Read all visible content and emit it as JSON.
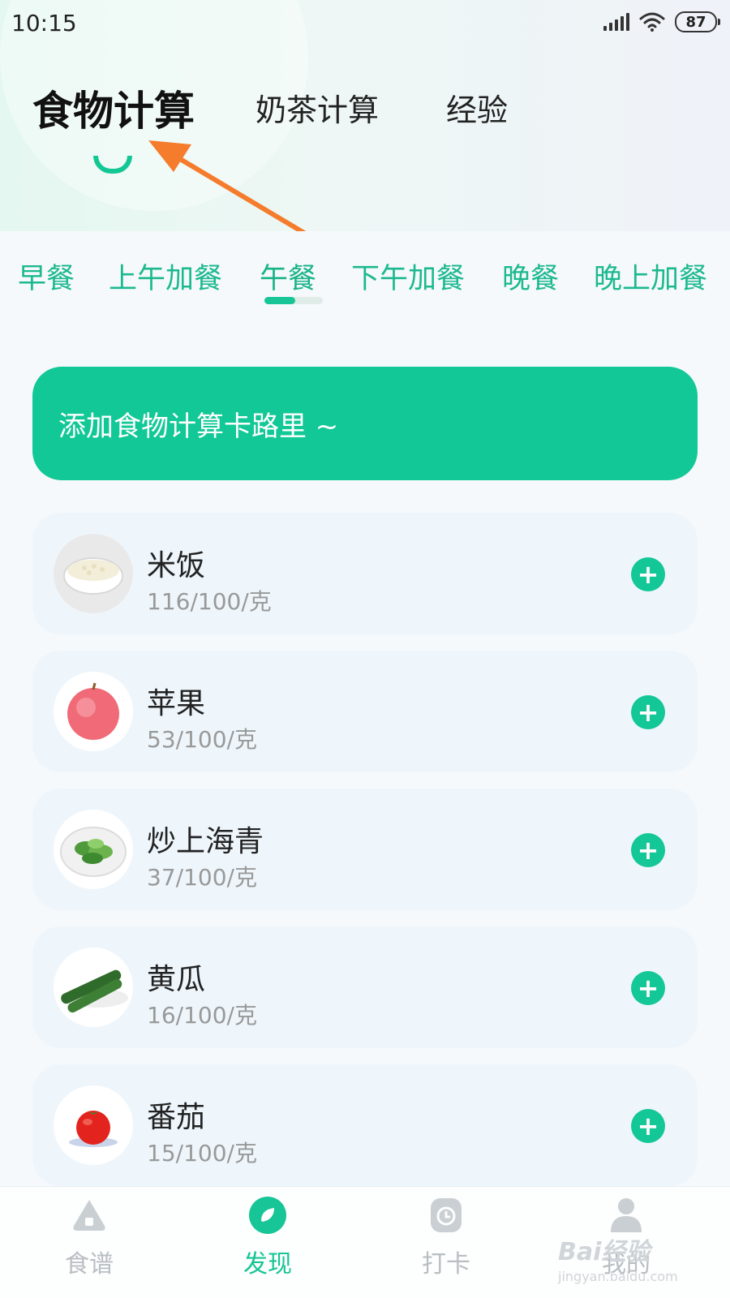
{
  "status_bar": {
    "time": "10:15",
    "battery": "87"
  },
  "main_tabs": [
    {
      "label": "食物计算",
      "active": true
    },
    {
      "label": "奶茶计算",
      "active": false
    },
    {
      "label": "经验",
      "active": false
    }
  ],
  "meal_tabs": [
    {
      "label": "早餐",
      "active": false
    },
    {
      "label": "上午加餐",
      "active": false
    },
    {
      "label": "午餐",
      "active": true
    },
    {
      "label": "下午加餐",
      "active": false
    },
    {
      "label": "晚餐",
      "active": false
    },
    {
      "label": "晚上加餐",
      "active": false
    }
  ],
  "add_banner": {
    "label": "添加食物计算卡路里 ~"
  },
  "foods": [
    {
      "name": "米饭",
      "calories": "116/100/克",
      "icon": "rice-bowl-icon"
    },
    {
      "name": "苹果",
      "calories": "53/100/克",
      "icon": "apple-icon"
    },
    {
      "name": "炒上海青",
      "calories": "37/100/克",
      "icon": "greens-plate-icon"
    },
    {
      "name": "黄瓜",
      "calories": "16/100/克",
      "icon": "cucumber-icon"
    },
    {
      "name": "番茄",
      "calories": "15/100/克",
      "icon": "tomato-icon"
    }
  ],
  "bottom_nav": [
    {
      "label": "食谱",
      "icon": "recipe-icon",
      "active": false
    },
    {
      "label": "发现",
      "icon": "discover-icon",
      "active": true
    },
    {
      "label": "打卡",
      "icon": "clock-icon",
      "active": false
    },
    {
      "label": "我的",
      "icon": "profile-icon",
      "active": false
    }
  ],
  "watermark": {
    "brand": "Bai经验",
    "url": "jingyan.baidu.com"
  },
  "colors": {
    "accent": "#13c796",
    "annotation": "#f47c2c"
  }
}
